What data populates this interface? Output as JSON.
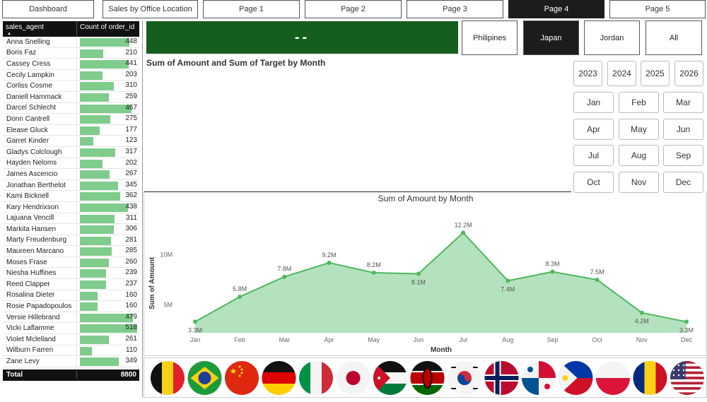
{
  "nav": {
    "items": [
      {
        "label": "Dashboard",
        "active": false
      },
      {
        "label": "Sales by Office Location",
        "active": false
      },
      {
        "label": "Page 1",
        "active": false
      },
      {
        "label": "Page 2",
        "active": false
      },
      {
        "label": "Page 3",
        "active": false
      },
      {
        "label": "Page 4",
        "active": true
      },
      {
        "label": "Page 5",
        "active": false
      }
    ]
  },
  "table": {
    "col1": "sales_agent",
    "col2": "Count of order_id",
    "max": 518,
    "rows": [
      {
        "name": "Anna Snelling",
        "count": 448
      },
      {
        "name": "Boris Faz",
        "count": 210
      },
      {
        "name": "Cassey Cress",
        "count": 441
      },
      {
        "name": "Cecily Lampkin",
        "count": 203
      },
      {
        "name": "Corliss Cosme",
        "count": 310
      },
      {
        "name": "Daniell Hammack",
        "count": 259
      },
      {
        "name": "Darcel Schlecht",
        "count": 467
      },
      {
        "name": "Donn Cantrell",
        "count": 275
      },
      {
        "name": "Elease Gluck",
        "count": 177
      },
      {
        "name": "Garret Kinder",
        "count": 123
      },
      {
        "name": "Gladys Colclough",
        "count": 317
      },
      {
        "name": "Hayden Neloms",
        "count": 202
      },
      {
        "name": "James Ascencio",
        "count": 267
      },
      {
        "name": "Jonathan Berthelot",
        "count": 345
      },
      {
        "name": "Kami Bicknell",
        "count": 362
      },
      {
        "name": "Kary Hendrixson",
        "count": 438
      },
      {
        "name": "Lajuana Vencill",
        "count": 311
      },
      {
        "name": "Markita Hansen",
        "count": 306
      },
      {
        "name": "Marty Freudenburg",
        "count": 281
      },
      {
        "name": "Maureen Marcano",
        "count": 285
      },
      {
        "name": "Moses Frase",
        "count": 260
      },
      {
        "name": "Niesha Huffines",
        "count": 239
      },
      {
        "name": "Reed Clapper",
        "count": 237
      },
      {
        "name": "Rosalina Dieter",
        "count": 160
      },
      {
        "name": "Rosie Papadopoulos",
        "count": 160
      },
      {
        "name": "Versie Hillebrand",
        "count": 479
      },
      {
        "name": "Vicki Laflamme",
        "count": 518
      },
      {
        "name": "Violet Mclelland",
        "count": 261
      },
      {
        "name": "Wilburn Farren",
        "count": 110
      },
      {
        "name": "Zane Levy",
        "count": 349
      }
    ],
    "total_label": "Total",
    "total_value": "8800"
  },
  "kpi": {
    "value": "--"
  },
  "countries": [
    {
      "label": "Philipines",
      "active": false
    },
    {
      "label": "Japan",
      "active": true
    },
    {
      "label": "Jordan",
      "active": false
    },
    {
      "label": "All",
      "active": false
    }
  ],
  "chart1_title": "Sum of Amount and Sum of Target by Month",
  "years": [
    "2023",
    "2024",
    "2025",
    "2026"
  ],
  "months": [
    "Jan",
    "Feb",
    "Mar",
    "Apr",
    "May",
    "Jun",
    "Jul",
    "Aug",
    "Sep",
    "Oct",
    "Nov",
    "Dec"
  ],
  "chart_data": {
    "type": "area",
    "title": "Sum of Amount by Month",
    "xlabel": "Month",
    "ylabel": "Sum of Amount",
    "categories": [
      "Jan",
      "Feb",
      "Mar",
      "Apr",
      "May",
      "Jun",
      "Jul",
      "Aug",
      "Sep",
      "Oct",
      "Nov",
      "Dec"
    ],
    "values": [
      3.3,
      5.8,
      7.8,
      9.2,
      8.2,
      8.1,
      12.2,
      7.4,
      8.3,
      7.5,
      4.2,
      3.3
    ],
    "labels": [
      "3.3M",
      "5.8M",
      "7.8M",
      "9.2M",
      "8.2M",
      "8.1M",
      "12.2M",
      "7.4M",
      "8.3M",
      "7.5M",
      "4.2M",
      "3.3M"
    ],
    "yticks": [
      {
        "v": 5,
        "label": "5M"
      },
      {
        "v": 10,
        "label": "10M"
      }
    ],
    "ylim": [
      2.2,
      13.5
    ],
    "grid": false,
    "color": "#4cb85f",
    "fill": "#b5e2be"
  },
  "flags": [
    "belgium-flag",
    "brazil-flag",
    "china-flag",
    "germany-flag",
    "italy-flag",
    "japan-flag",
    "jordan-flag",
    "kenya-flag",
    "south-korea-flag",
    "norway-flag",
    "panama-flag",
    "philippines-flag",
    "poland-flag",
    "romania-flag",
    "usa-flag"
  ]
}
